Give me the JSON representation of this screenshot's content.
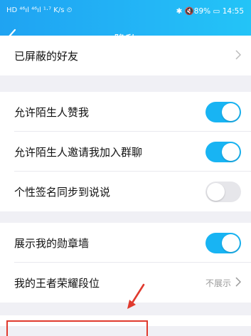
{
  "status": {
    "left": "HD ⁴⁶ıl ⁴⁶ıl  ¹·⁷ K/s  ⏲",
    "right": "✱ 🔇89% ▭ 14:55"
  },
  "header": {
    "title": "隐私"
  },
  "rows": {
    "blocked_friends": "已屏蔽的好友",
    "allow_likes": "允许陌生人赞我",
    "allow_group_invite": "允许陌生人邀请我加入群聊",
    "sync_signature": "个性签名同步到说说",
    "show_medal_wall": "展示我的勋章墙",
    "honor_of_kings_rank": "我的王者荣耀段位",
    "honor_of_kings_value": "不展示"
  },
  "toggles": {
    "allow_likes": true,
    "allow_group_invite": true,
    "sync_signature": false,
    "show_medal_wall": true
  },
  "colors": {
    "header_start": "#1fa3f2",
    "toggle_on": "#18b4f3",
    "annotation_red": "#e03a2e"
  }
}
